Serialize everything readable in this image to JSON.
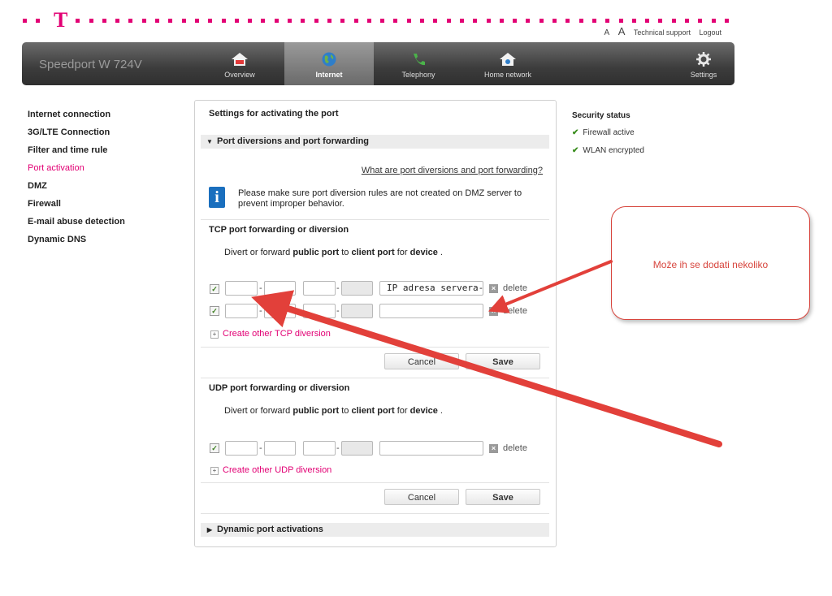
{
  "header": {
    "brand": "Speedport W 724V",
    "logo_letter": "T",
    "font_small": "A",
    "font_large": "A",
    "technical_support": "Technical support",
    "logout": "Logout"
  },
  "nav": {
    "items": [
      {
        "label": "Overview",
        "icon": "house-icon"
      },
      {
        "label": "Internet",
        "icon": "globe-icon",
        "active": true
      },
      {
        "label": "Telephony",
        "icon": "phone-icon"
      },
      {
        "label": "Home network",
        "icon": "home-network-icon"
      }
    ],
    "settings_label": "Settings"
  },
  "sidebar": {
    "items": [
      {
        "label": "Internet connection"
      },
      {
        "label": "3G/LTE Connection"
      },
      {
        "label": "Filter and time rule"
      },
      {
        "label": "Port activation",
        "active": true
      },
      {
        "label": "DMZ"
      },
      {
        "label": "Firewall"
      },
      {
        "label": "E-mail abuse detection"
      },
      {
        "label": "Dynamic DNS"
      }
    ]
  },
  "main": {
    "title": "Settings for activating the port",
    "section_port": "Port diversions and port forwarding",
    "help_link": "What are port diversions and port forwarding?",
    "info_icon_letter": "i",
    "info_text": "Please make sure port diversion rules are not created on DMZ server to prevent improper behavior.",
    "desc": {
      "p1": "Divert or forward ",
      "b1": "public port",
      "p2": " to ",
      "b2": "client port",
      "p3": " for ",
      "b3": "device",
      "p4": " ."
    },
    "tcp": {
      "heading": "TCP port forwarding or diversion",
      "rows": [
        {
          "checked": true,
          "ip_value": "IP adresa servera-",
          "delete": "delete"
        },
        {
          "checked": true,
          "ip_value": "",
          "delete": "delete"
        }
      ],
      "create_link": "Create other TCP diversion",
      "cancel": "Cancel",
      "save": "Save"
    },
    "udp": {
      "heading": "UDP port forwarding or diversion",
      "rows": [
        {
          "checked": true,
          "ip_value": "",
          "delete": "delete"
        }
      ],
      "create_link": "Create other UDP diversion",
      "cancel": "Cancel",
      "save": "Save"
    },
    "section_dynamic": "Dynamic port activations"
  },
  "security": {
    "title": "Security status",
    "items": [
      "Firewall active",
      "WLAN encrypted"
    ]
  },
  "annotation": {
    "callout_text": "Može ih se dodati nekoliko",
    "color": "#d7443c"
  },
  "colors": {
    "brand_magenta": "#e20074",
    "nav_dark": "#3c3c3c"
  }
}
